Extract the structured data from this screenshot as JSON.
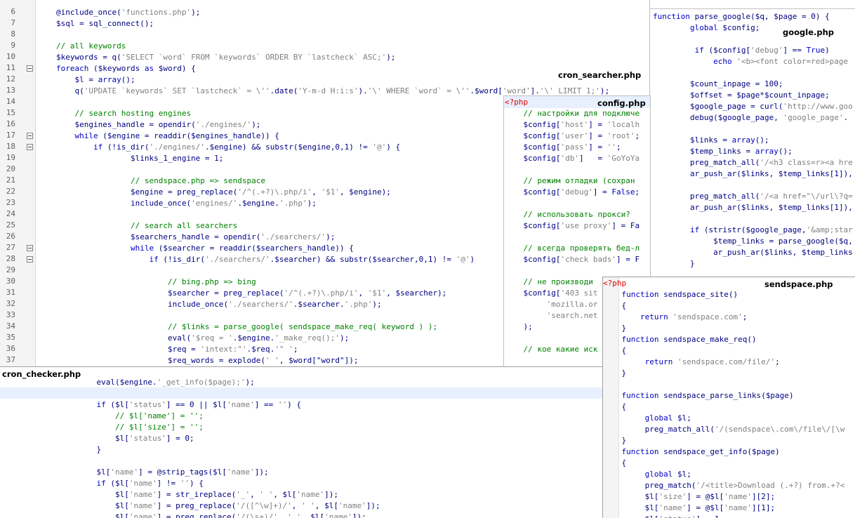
{
  "titles": {
    "cron_searcher": "cron_searcher.php",
    "google": "google.php",
    "config": "config.php",
    "sendspace": "sendspace.php",
    "cron_checker": "cron_checker.php"
  },
  "main_editor": {
    "line_numbers": [
      "6",
      "7",
      "8",
      "9",
      "10",
      "11",
      "12",
      "13",
      "14",
      "15",
      "16",
      "17",
      "18",
      "19",
      "20",
      "21",
      "22",
      "23",
      "24",
      "25",
      "26",
      "27",
      "28",
      "29",
      "30",
      "31",
      "32",
      "33",
      "34",
      "35",
      "36",
      "37"
    ],
    "lines": [
      "@include_once('functions.php');",
      "$sql = sql_connect();",
      "",
      "// all keywords",
      "$keywords = q('SELECT `word` FROM `keywords` ORDER BY `lastcheck` ASC;');",
      "foreach ($keywords as $word) {",
      "    $l = array();",
      "    q('UPDATE `keywords` SET `lastcheck` = \\''.date('Y-m-d H:i:s').'\\' WHERE `word` = \\''.$word['word'].'\\' LIMIT 1;');",
      "",
      "    // search hosting engines",
      "    $engines_handle = opendir('./engines/');",
      "    while ($engine = readdir($engines_handle)) {",
      "        if (!is_dir('./engines/'.$engine) && substr($engine,0,1) != '@') {",
      "                $links_1_engine = 1;",
      "",
      "                // sendspace.php => sendspace",
      "                $engine = preg_replace('/^(.+?)\\.php/i', '$1', $engine);",
      "                include_once('engines/'.$engine.'.php');",
      "",
      "                // search all searchers",
      "                $searchers_handle = opendir('./searchers/');",
      "                while ($searcher = readdir($searchers_handle)) {",
      "                    if (!is_dir('./searchers/'.$searcher) && substr($searcher,0,1) != '@')",
      "",
      "                        // bing.php => bing",
      "                        $searcher = preg_replace('/^(.+?)\\.php/i', '$1', $searcher);",
      "                        include_once('./searchers/'.$searcher.'.php');",
      "",
      "                        // $links = parse_google( sendspace_make_req( keyword ) );",
      "                        eval('$req = '.$engine.'_make_req();');",
      "                        $req = 'intext:\"'.$req.'\" ';",
      "                        $req_words = explode(' ', $word[\"word\"]);"
    ]
  },
  "google_editor": {
    "lines": [
      "function parse_google($q, $page = 0) {",
      "        global $config;",
      "",
      "         if ($config['debug'] == True)",
      "             echo '<b><font color=red>page",
      "",
      "        $count_inpage = 100;",
      "        $offset = $page*$count_inpage;",
      "        $google_page = curl('http://www.goo",
      "        debug($google_page, 'google_page'.$",
      "",
      "        $links = array();",
      "        $temp_links = array();",
      "        preg_match_all('/<h3 class=r><a hre",
      "        ar_push_ar($links, $temp_links[1]),",
      "",
      "        preg_match_all('/<a href=\"\\/url\\?q=",
      "        ar_push_ar($links, $temp_links[1]),",
      "",
      "        if (stristr($google_page,'&amp;star",
      "             $temp_links = parse_google($q,",
      "             ar_push_ar($links, $temp_links",
      "        }"
    ]
  },
  "config_editor": {
    "lines": [
      "<?php",
      "    // настройки для подключе",
      "    $config['host'] = 'localh",
      "    $config['user'] = 'root';",
      "    $config['pass'] = '';",
      "    $config['db']   = 'GoYoYa",
      "",
      "    // режим отладки (сохран",
      "    $config['debug'] = False;",
      "",
      "    // использовать прокси?",
      "    $config['use proxy'] = Fa",
      "",
      "    // всегда проверять бед-л",
      "    $config['check bads'] = F",
      "",
      "    // не производи",
      "    $config['403 sit",
      "         'mozilla.or",
      "         'search.net",
      "    );",
      "",
      "    // кое какие иск"
    ]
  },
  "sendspace_editor": {
    "lines": [
      "<?php",
      "    function sendspace_site()",
      "    {",
      "        return 'sendspace.com';",
      "    }",
      "    function sendspace_make_req()",
      "    {",
      "         return 'sendspace.com/file/';",
      "    }",
      "",
      "    function sendspace_parse_links($page)",
      "    {",
      "         global $l;",
      "         preg_match_all('/(sendspace\\.com\\/file\\/[\\w",
      "    }",
      "    function sendspace_get_info($page)",
      "    {",
      "         global $l;",
      "         preg_match('/<title>Download (.+?) from.+?<",
      "         $l['size'] = @$l['name'][2];",
      "         $l['name'] = @$l['name'][1];",
      "         $l['status'] = 1"
    ]
  },
  "checker_editor": {
    "lines": [
      "    eval($engine.'_get_info($page);');",
      "",
      "    if ($l['status'] == 0 || $l['name'] == '') {",
      "        // $l['name'] = '';",
      "        // $l['size'] = '';",
      "        $l['status'] = 0;",
      "    }",
      "",
      "    $l['name'] = @strip_tags($l['name']);",
      "    if ($l['name'] != '') {",
      "        $l['name'] = str_ireplace('_', ' ', $l['name']);",
      "        $l['name'] = preg_replace('/([^\\w]+)/', ' ', $l['name']);",
      "        $l['name'] = preg_replace('/(\\s+)/', ' ', $l['name']);"
    ]
  },
  "colors": {
    "keyword": "#0000c0",
    "variable": "#000080",
    "string": "#808080",
    "comment": "#008000",
    "php_tag": "#e00000",
    "current_line": "#e8f0ff"
  }
}
